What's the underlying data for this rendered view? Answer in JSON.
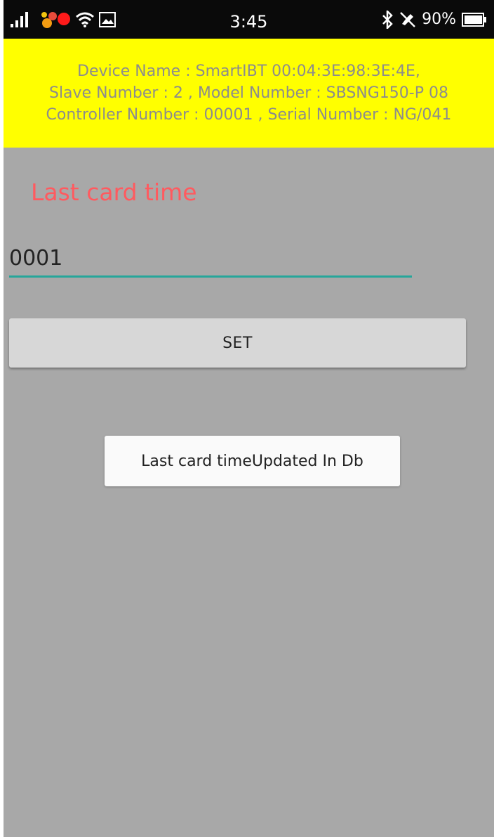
{
  "status_bar": {
    "time": "3:45",
    "battery": "90%",
    "icons": [
      "signal-icon",
      "app-notification-icon",
      "wifi-icon",
      "image-icon",
      "bluetooth-icon",
      "mute-icon",
      "battery-icon"
    ]
  },
  "device_info": {
    "line1": "Device Name  : SmartIBT 00:04:3E:98:3E:4E,",
    "line2": "Slave Number : 2 , Model Number :    SBSNG150-P 08",
    "line3": "Controller Number : 00001 , Serial Number : NG/041",
    "background": "#ffff00"
  },
  "form": {
    "title": "Last card time",
    "title_color": "#ff5a5f",
    "input_value": "0001",
    "underline_color": "#26a69a",
    "set_label": "SET"
  },
  "toast": {
    "message": "Last card timeUpdated In Db"
  }
}
